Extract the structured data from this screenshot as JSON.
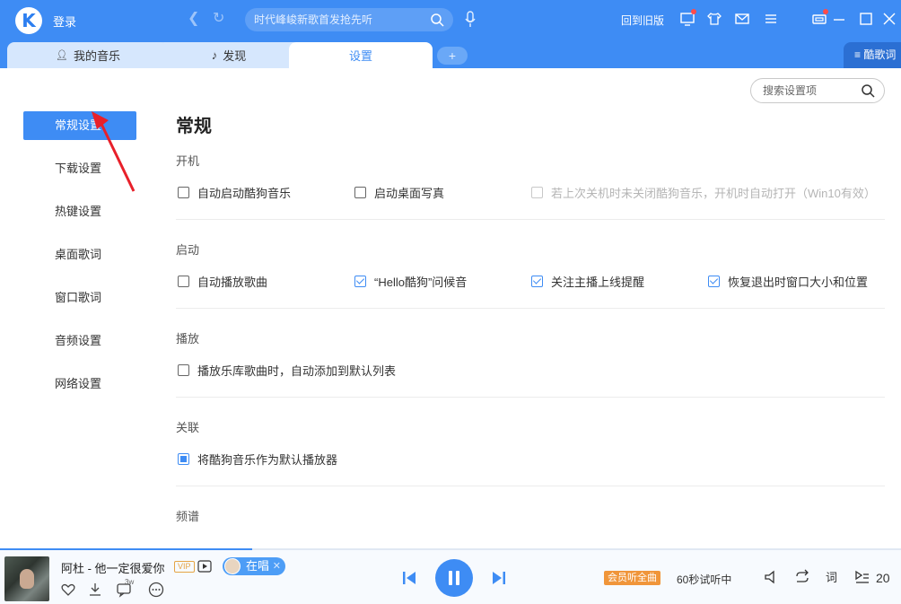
{
  "titlebar": {
    "logo_letter": "K",
    "login": "登录",
    "search_placeholder": "时代峰峻新歌首发抢先听",
    "back_old": "回到旧版"
  },
  "tabs": [
    {
      "label": "我的音乐"
    },
    {
      "label": "发现"
    },
    {
      "label": "设置"
    },
    {
      "label": "+"
    }
  ],
  "lyrics_tab": "酷歌词",
  "settings": {
    "search_placeholder": "搜索设置项",
    "sidebar": [
      {
        "label": "常规设置",
        "active": true
      },
      {
        "label": "下载设置"
      },
      {
        "label": "热键设置"
      },
      {
        "label": "桌面歌词"
      },
      {
        "label": "窗口歌词"
      },
      {
        "label": "音频设置"
      },
      {
        "label": "网络设置"
      }
    ],
    "title": "常规",
    "sections": [
      {
        "label": "开机",
        "options": [
          {
            "label": "自动启动酷狗音乐",
            "checked": false
          },
          {
            "label": "启动桌面写真",
            "checked": false
          },
          {
            "label": "若上次关机时未关闭酷狗音乐，开机时自动打开（Win10有效）",
            "checked": false,
            "disabled": true
          }
        ]
      },
      {
        "label": "启动",
        "options": [
          {
            "label": "自动播放歌曲",
            "checked": false
          },
          {
            "label": "“Hello酷狗”问候音",
            "checked": true
          },
          {
            "label": "关注主播上线提醒",
            "checked": true
          },
          {
            "label": "恢复退出时窗口大小和位置",
            "checked": true
          }
        ]
      },
      {
        "label": "播放",
        "options": [
          {
            "label": "播放乐库歌曲时，自动添加到默认列表",
            "checked": false
          }
        ]
      },
      {
        "label": "关联",
        "options": [
          {
            "label": "将酷狗音乐作为默认播放器",
            "checked": true
          }
        ]
      },
      {
        "label": "频谱",
        "options": []
      }
    ]
  },
  "player": {
    "song": "阿杜 - 他一定很爱你",
    "vip": "VIP",
    "singing": "在唱",
    "comment_count": "3w",
    "member_btn": "会员听全曲",
    "trial": "60秒试听中",
    "playlist_count": "20",
    "progress": 0.28
  },
  "colors": {
    "accent": "#3e8cf4",
    "member": "#f0953a"
  }
}
